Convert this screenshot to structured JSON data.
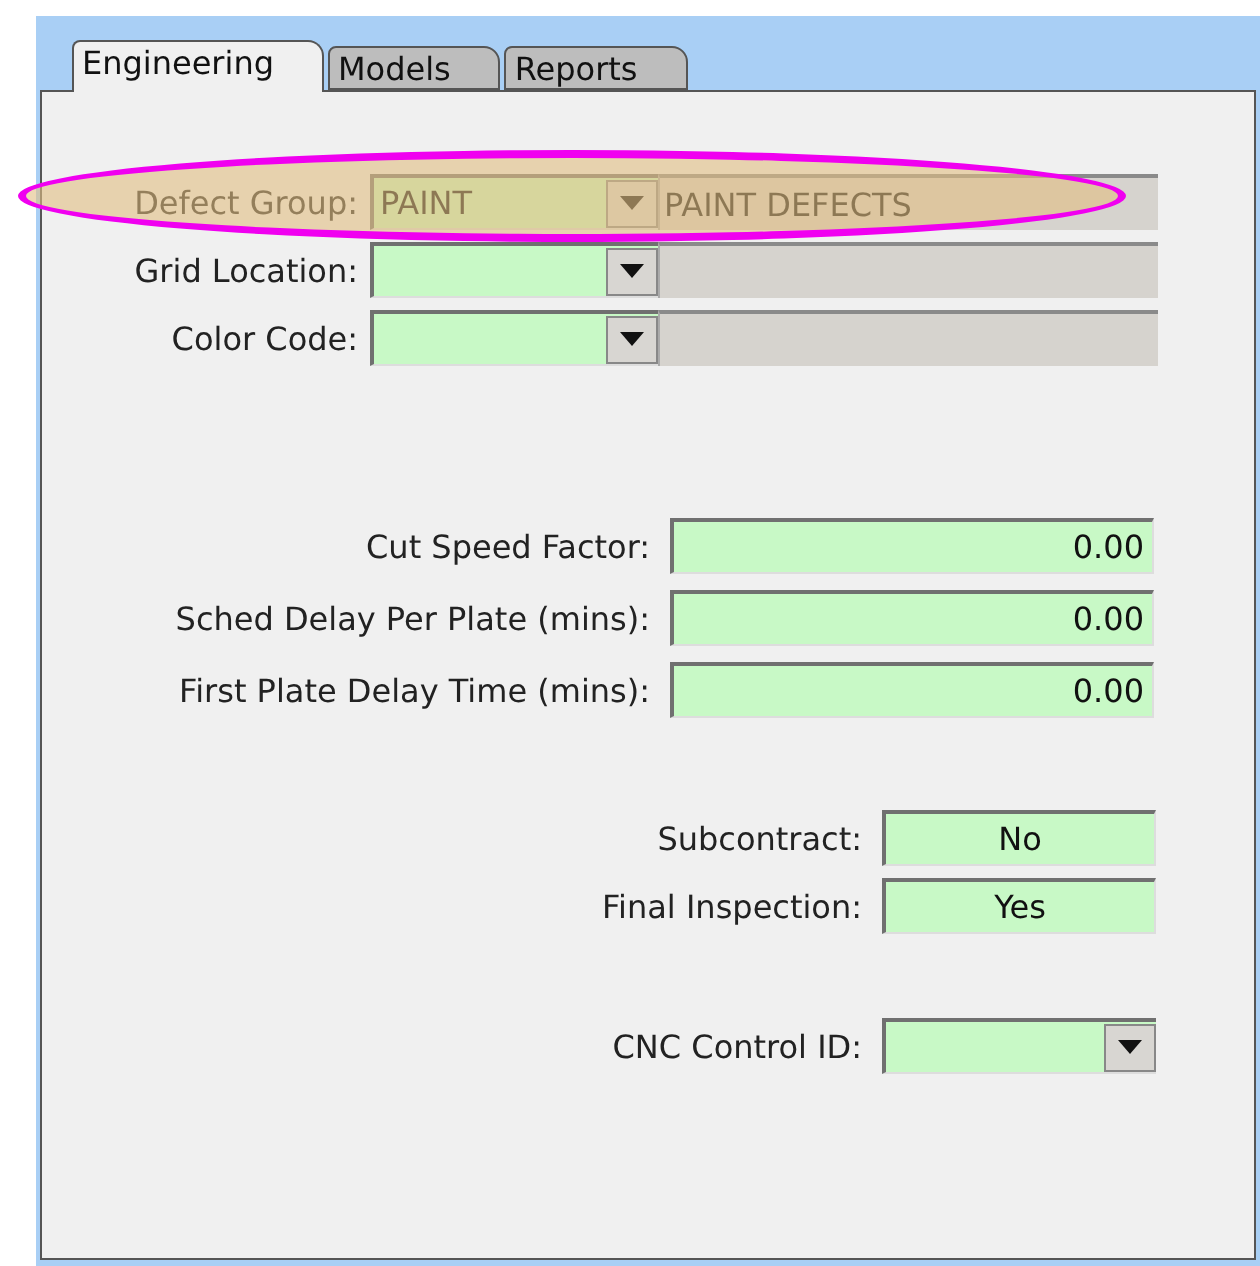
{
  "tabs": [
    {
      "label": "Engineering",
      "selected": true
    },
    {
      "label": "Models",
      "selected": false
    },
    {
      "label": "Reports",
      "selected": false
    }
  ],
  "lookups": [
    {
      "label": "Defect Group:",
      "code": "PAINT",
      "description": "PAINT DEFECTS",
      "highlighted": true
    },
    {
      "label": "Grid Location:",
      "highlighted": false
    },
    {
      "label": "Color Code:",
      "highlighted": false
    }
  ],
  "numeric_fields": [
    {
      "label": "Cut Speed Factor:",
      "value": "0.00"
    },
    {
      "label": "Sched Delay Per Plate (mins):",
      "value": "0.00"
    },
    {
      "label": "First Plate Delay Time (mins):",
      "value": "0.00"
    }
  ],
  "flags": [
    {
      "label": "Subcontract:",
      "value": "No"
    },
    {
      "label": "Final Inspection:",
      "value": "Yes"
    }
  ],
  "cnc": {
    "label": "CNC Control ID:"
  }
}
